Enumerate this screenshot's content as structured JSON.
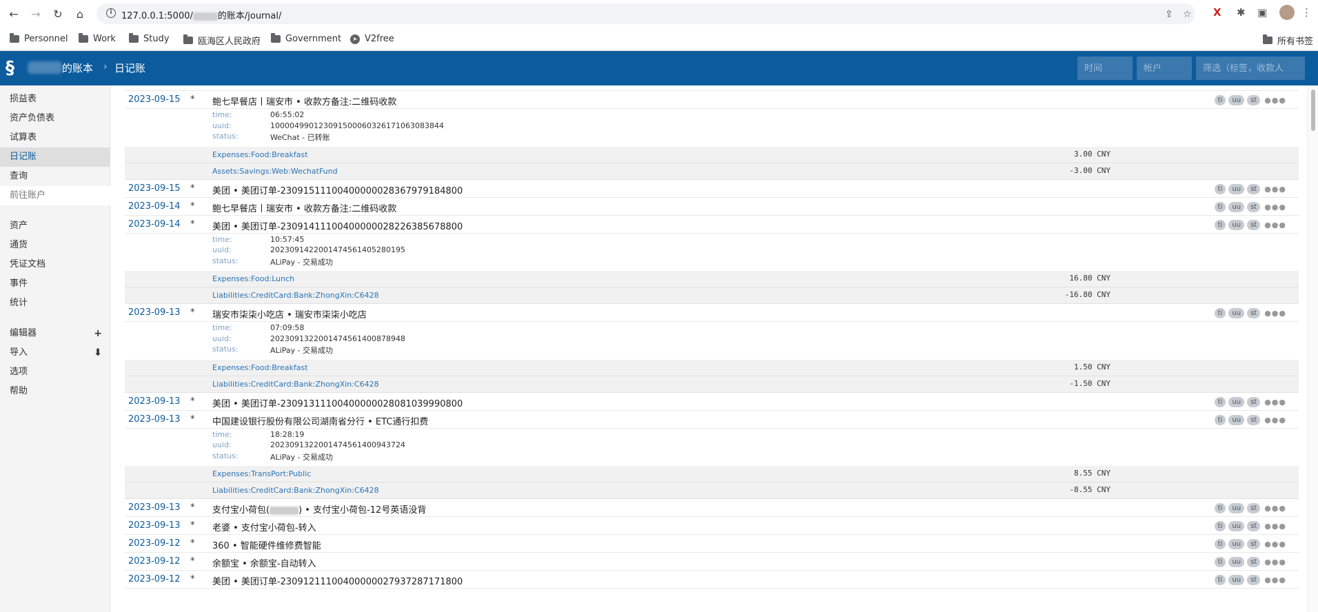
{
  "browser": {
    "url_prefix": "127.0.0.1:5000/",
    "url_suffix": "的账本/journal/",
    "bookmarks": [
      {
        "label": "Personnel",
        "icon": "folder-icon"
      },
      {
        "label": "Work",
        "icon": "folder-icon"
      },
      {
        "label": "Study",
        "icon": "folder-icon"
      },
      {
        "label": "瓯海区人民政府",
        "icon": "folder-icon"
      },
      {
        "label": "Government",
        "icon": "folder-icon"
      },
      {
        "label": "V2free",
        "icon": "telegram-icon"
      }
    ],
    "all_bookmarks": "所有书签"
  },
  "header": {
    "ledger_name": "的账本",
    "separator": "›",
    "page": "日记账",
    "time_placeholder": "时间",
    "account_placeholder": "帐户",
    "filter_placeholder": "筛选（标签，收款人"
  },
  "sidebar": {
    "group1": [
      "损益表",
      "资产负债表",
      "试算表",
      "日记账",
      "查询"
    ],
    "goto": "前往账户",
    "group2": [
      "资产",
      "通货",
      "凭证文档",
      "事件",
      "统计"
    ],
    "group3": [
      "编辑器",
      "导入",
      "选项",
      "帮助"
    ],
    "editor_action": "+",
    "import_action": "⬇"
  },
  "journal": {
    "tags": [
      "ti",
      "uu",
      "st"
    ],
    "dots": "●●●",
    "entries": [
      {
        "date": "2023-09-15",
        "flag": "*",
        "narration": "鲍七早餐店丨瑞安市 • 收款方备注:二维码收款",
        "meta": [
          {
            "k": "time:",
            "v": "06:55:02"
          },
          {
            "k": "uuid:",
            "v": "10000499012309150006032617106308​3844"
          },
          {
            "k": "status:",
            "v": "WeChat - 已转账"
          }
        ],
        "postings": [
          {
            "account": "Expenses:Food:Breakfast",
            "amount": "3.00 CNY"
          },
          {
            "account": "Assets:Savings:Web:WechatFund",
            "amount": "-3.00 CNY"
          }
        ]
      },
      {
        "date": "2023-09-15",
        "flag": "*",
        "narration": "美团 • 美团订单-23091511100400000028367979184800"
      },
      {
        "date": "2023-09-14",
        "flag": "*",
        "narration": "鲍七早餐店丨瑞安市 • 收款方备注:二维码收款"
      },
      {
        "date": "2023-09-14",
        "flag": "*",
        "narration": "美团 • 美团订单-23091411100400000028226385678800",
        "meta": [
          {
            "k": "time:",
            "v": "10:57:45"
          },
          {
            "k": "uuid:",
            "v": "2023091422001474561405280195"
          },
          {
            "k": "status:",
            "v": "ALiPay - 交易成功"
          }
        ],
        "postings": [
          {
            "account": "Expenses:Food:Lunch",
            "amount": "16.80 CNY"
          },
          {
            "account": "Liabilities:CreditCard:Bank:ZhongXin:C6428",
            "amount": "-16.80 CNY"
          }
        ]
      },
      {
        "date": "2023-09-13",
        "flag": "*",
        "narration": "瑞安市柒柒小吃店 • 瑞安市柒柒小吃店",
        "meta": [
          {
            "k": "time:",
            "v": "07:09:58"
          },
          {
            "k": "uuid:",
            "v": "2023091322001474561400878948"
          },
          {
            "k": "status:",
            "v": "ALiPay - 交易成功"
          }
        ],
        "postings": [
          {
            "account": "Expenses:Food:Breakfast",
            "amount": "1.50 CNY"
          },
          {
            "account": "Liabilities:CreditCard:Bank:ZhongXin:C6428",
            "amount": "-1.50 CNY"
          }
        ]
      },
      {
        "date": "2023-09-13",
        "flag": "*",
        "narration": "美团 • 美团订单-23091311100400000028081039990800"
      },
      {
        "date": "2023-09-13",
        "flag": "*",
        "narration": "中国建设银行股份有限公司湖南省分行 • ETC通行扣费",
        "meta": [
          {
            "k": "time:",
            "v": "18:28:19"
          },
          {
            "k": "uuid:",
            "v": "2023091322001474561400943724"
          },
          {
            "k": "status:",
            "v": "ALiPay - 交易成功"
          }
        ],
        "postings": [
          {
            "account": "Expenses:TransPort:Public",
            "amount": "8.55 CNY"
          },
          {
            "account": "Liabilities:CreditCard:Bank:ZhongXin:C6428",
            "amount": "-8.55 CNY"
          }
        ]
      },
      {
        "date": "2023-09-13",
        "flag": "*",
        "narration_a": "支付宝小荷包(",
        "narration_b": ") • 支付宝小荷包-12号英语没背"
      },
      {
        "date": "2023-09-13",
        "flag": "*",
        "narration": "老婆 • 支付宝小荷包-转入"
      },
      {
        "date": "2023-09-12",
        "flag": "*",
        "narration": "360 • 智能硬件维修费智能"
      },
      {
        "date": "2023-09-12",
        "flag": "*",
        "narration": "余额宝 • 余额宝-自动转入"
      },
      {
        "date": "2023-09-12",
        "flag": "*",
        "narration": "美团 • 美团订单-23091211100400000027937287171800"
      }
    ]
  }
}
